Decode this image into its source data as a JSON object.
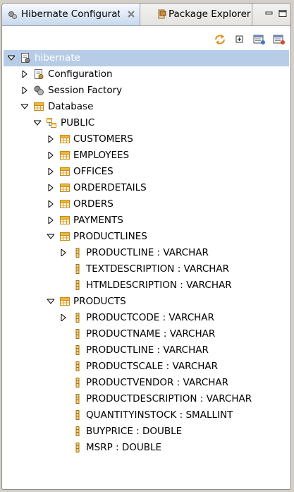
{
  "tabs": {
    "active": {
      "label": "Hibernate Configurati"
    },
    "inactive": {
      "label": "Package Explorer"
    }
  },
  "tree": {
    "root": {
      "label": "hibernate"
    },
    "configuration": {
      "label": "Configuration"
    },
    "session_factory": {
      "label": "Session Factory"
    },
    "database": {
      "label": "Database"
    },
    "schema": {
      "label": "PUBLIC"
    },
    "tables": {
      "customers": "CUSTOMERS",
      "employees": "EMPLOYEES",
      "offices": "OFFICES",
      "orderdetails": "ORDERDETAILS",
      "orders": "ORDERS",
      "payments": "PAYMENTS",
      "productlines": "PRODUCTLINES",
      "products": "PRODUCTS"
    },
    "productlines_columns": [
      "PRODUCTLINE : VARCHAR",
      "TEXTDESCRIPTION : VARCHAR",
      "HTMLDESCRIPTION : VARCHAR"
    ],
    "products_columns": [
      "PRODUCTCODE : VARCHAR",
      "PRODUCTNAME : VARCHAR",
      "PRODUCTLINE : VARCHAR",
      "PRODUCTSCALE : VARCHAR",
      "PRODUCTVENDOR : VARCHAR",
      "PRODUCTDESCRIPTION : VARCHAR",
      "QUANTITYINSTOCK : SMALLINT",
      "BUYPRICE : DOUBLE",
      "MSRP : DOUBLE"
    ]
  },
  "colors": {
    "selection": "#b7cce7",
    "tab_active": "#c6d8ee",
    "table_icon": "#c58a18",
    "column_icon": "#b07c10"
  }
}
